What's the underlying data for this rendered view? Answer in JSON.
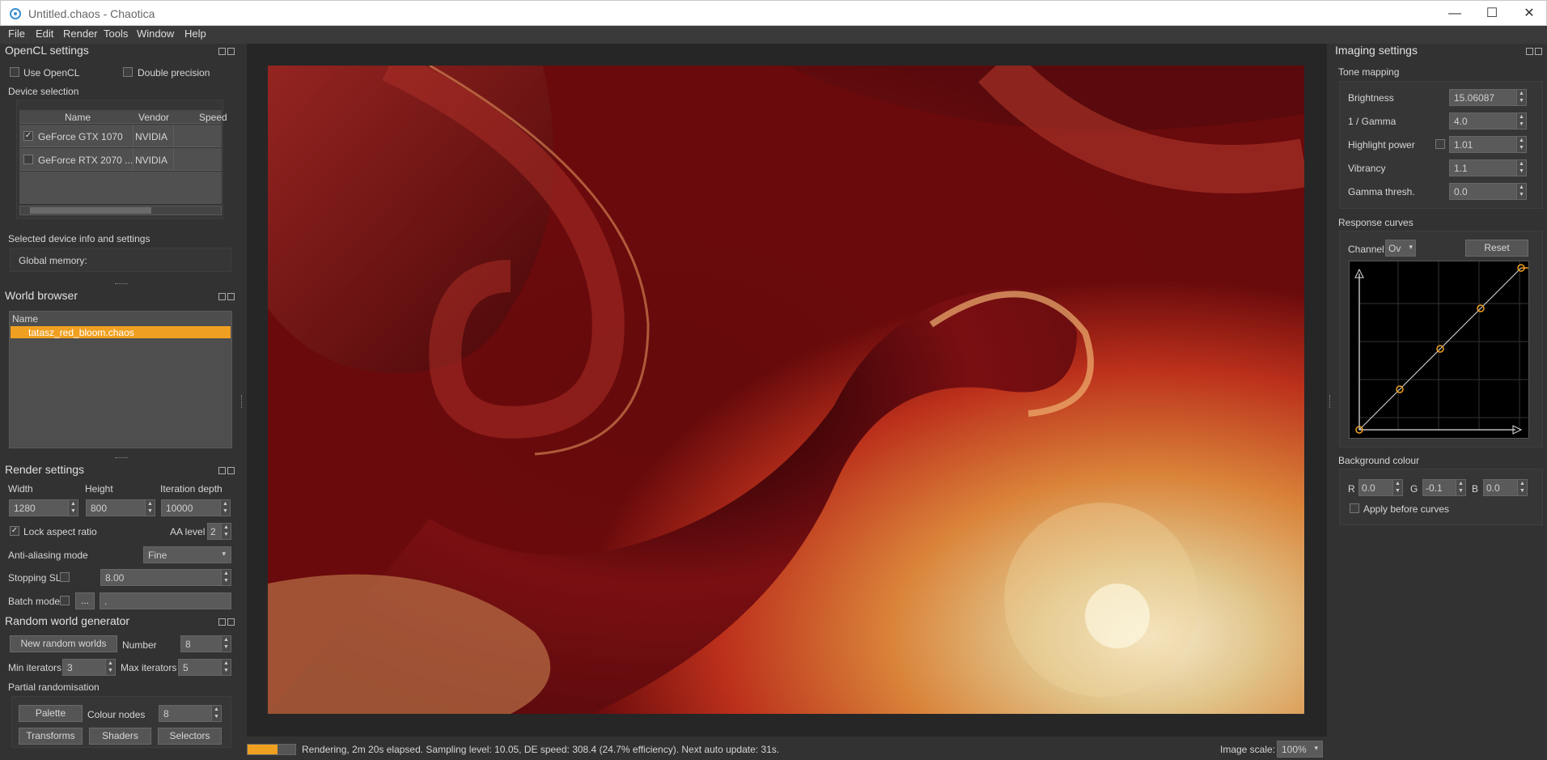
{
  "window": {
    "title": "Untitled.chaos - Chaotica",
    "minimize": "—",
    "maximize": "☐",
    "close": "✕"
  },
  "menu": [
    "File",
    "Edit",
    "Render",
    "Tools",
    "Window",
    "Help"
  ],
  "opencl": {
    "title": "OpenCL settings",
    "use_opencl": "Use OpenCL",
    "double_precision": "Double precision",
    "device_selection": "Device selection",
    "columns": [
      "Name",
      "Vendor",
      "Speed"
    ],
    "devices": [
      {
        "checked": true,
        "name": "GeForce GTX 1070",
        "vendor": "NVIDIA",
        "speed": ""
      },
      {
        "checked": false,
        "name": "GeForce RTX 2070 ...",
        "vendor": "NVIDIA",
        "speed": ""
      }
    ],
    "selected_info": "Selected device info and settings",
    "global_memory": "Global memory:"
  },
  "world_browser": {
    "title": "World browser",
    "column": "Name",
    "items": [
      "tatasz_red_bloom.chaos"
    ]
  },
  "render": {
    "title": "Render settings",
    "width_label": "Width",
    "height_label": "Height",
    "iter_label": "Iteration depth",
    "width": "1280",
    "height": "800",
    "iteration_depth": "10000",
    "lock_aspect": "Lock aspect ratio",
    "aa_level_label": "AA level",
    "aa_level": "2",
    "aa_mode_label": "Anti-aliasing mode",
    "aa_mode": "Fine",
    "stopping_sl_label": "Stopping SL",
    "stopping_sl": "8.00",
    "batch_mode_label": "Batch mode",
    "batch_browse": "...",
    "batch_path": "."
  },
  "random": {
    "title": "Random world generator",
    "new_worlds": "New random worlds",
    "number_label": "Number",
    "number": "8",
    "min_iter_label": "Min iterators",
    "min_iter": "3",
    "max_iter_label": "Max iterators",
    "max_iter": "5",
    "partial": "Partial randomisation",
    "palette": "Palette",
    "colour_nodes_label": "Colour nodes",
    "colour_nodes": "8",
    "transforms": "Transforms",
    "shaders": "Shaders",
    "selectors": "Selectors"
  },
  "imaging": {
    "title": "Imaging settings",
    "tone_mapping": "Tone mapping",
    "brightness_label": "Brightness",
    "brightness": "15.06087",
    "gamma_label": "1 / Gamma",
    "gamma": "4.0",
    "highlight_label": "Highlight power",
    "highlight": "1.01",
    "vibrancy_label": "Vibrancy",
    "vibrancy": "1.1",
    "gamma_thresh_label": "Gamma thresh.",
    "gamma_thresh": "0.0",
    "response_curves": "Response curves",
    "channel_label": "Channel:",
    "channel": "Ov",
    "reset": "Reset",
    "background_colour": "Background colour",
    "r_label": "R",
    "r": "0.0",
    "g_label": "G",
    "g": "-0.1",
    "b_label": "B",
    "b": "0.0",
    "apply_before_curves": "Apply before curves"
  },
  "status": {
    "text": "Rendering, 2m 20s elapsed. Sampling level: 10.05, DE speed: 308.4 (24.7% efficiency). Next auto update: 31s.",
    "progress": 0.62,
    "image_scale_label": "Image scale:",
    "image_scale": "100%"
  },
  "colors": {
    "accent": "#f0a020",
    "panel": "#323232"
  }
}
